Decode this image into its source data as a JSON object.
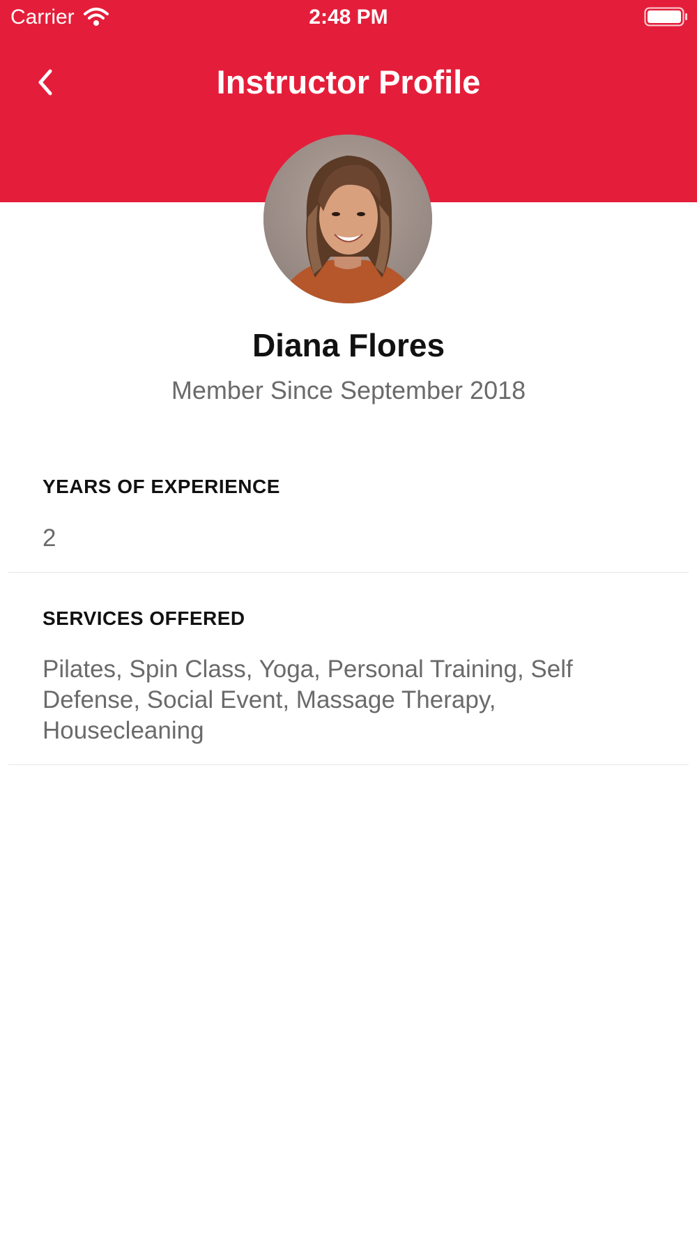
{
  "status_bar": {
    "carrier": "Carrier",
    "time": "2:48 PM"
  },
  "header": {
    "title": "Instructor Profile",
    "back_icon": "chevron-left-icon",
    "background_color": "#e41e3a"
  },
  "profile": {
    "name": "Diana Flores",
    "member_since": "Member Since September 2018"
  },
  "sections": [
    {
      "label": "YEARS OF EXPERIENCE",
      "value": "2"
    },
    {
      "label": "SERVICES OFFERED",
      "value": "Pilates, Spin Class, Yoga, Personal Training, Self Defense, Social Event, Massage Therapy, Housecleaning"
    }
  ]
}
